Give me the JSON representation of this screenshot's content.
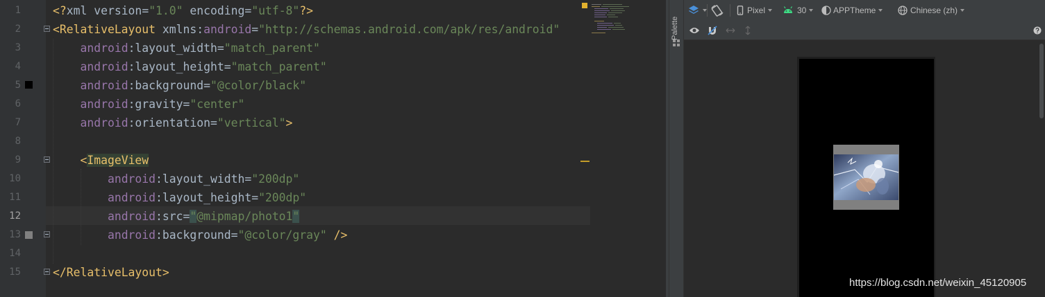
{
  "editor": {
    "line_numbers": [
      "1",
      "2",
      "3",
      "4",
      "5",
      "6",
      "7",
      "8",
      "9",
      "10",
      "11",
      "12",
      "13",
      "14",
      "15"
    ],
    "current_line": "12",
    "lines": [
      {
        "tokens": [
          {
            "t": "<?",
            "c": "t-punct"
          },
          {
            "t": "xml version",
            "c": "t-txt"
          },
          {
            "t": "=",
            "c": "t-txt"
          },
          {
            "t": "\"1.0\"",
            "c": "t-str"
          },
          {
            "t": " encoding",
            "c": "t-txt"
          },
          {
            "t": "=",
            "c": "t-txt"
          },
          {
            "t": "\"utf-8\"",
            "c": "t-str"
          },
          {
            "t": "?>",
            "c": "t-punct"
          }
        ]
      },
      {
        "tokens": [
          {
            "t": "<",
            "c": "t-punct"
          },
          {
            "t": "RelativeLayout",
            "c": "t-tag"
          },
          {
            "t": " xmlns",
            "c": "t-txt"
          },
          {
            "t": ":",
            "c": "t-txt"
          },
          {
            "t": "android",
            "c": "t-ns"
          },
          {
            "t": "=",
            "c": "t-txt"
          },
          {
            "t": "\"http://schemas.android.com/apk/res/android\"",
            "c": "t-str"
          }
        ]
      },
      {
        "tokens": [
          {
            "t": "    ",
            "c": "t-txt"
          },
          {
            "t": "android",
            "c": "t-ns"
          },
          {
            "t": ":layout_width",
            "c": "t-txt"
          },
          {
            "t": "=",
            "c": "t-txt"
          },
          {
            "t": "\"match_parent\"",
            "c": "t-str"
          }
        ]
      },
      {
        "tokens": [
          {
            "t": "    ",
            "c": "t-txt"
          },
          {
            "t": "android",
            "c": "t-ns"
          },
          {
            "t": ":layout_height",
            "c": "t-txt"
          },
          {
            "t": "=",
            "c": "t-txt"
          },
          {
            "t": "\"match_parent\"",
            "c": "t-str"
          }
        ]
      },
      {
        "tokens": [
          {
            "t": "    ",
            "c": "t-txt"
          },
          {
            "t": "android",
            "c": "t-ns"
          },
          {
            "t": ":background",
            "c": "t-txt"
          },
          {
            "t": "=",
            "c": "t-txt"
          },
          {
            "t": "\"@color/black\"",
            "c": "t-str"
          }
        ]
      },
      {
        "tokens": [
          {
            "t": "    ",
            "c": "t-txt"
          },
          {
            "t": "android",
            "c": "t-ns"
          },
          {
            "t": ":gravity",
            "c": "t-txt"
          },
          {
            "t": "=",
            "c": "t-txt"
          },
          {
            "t": "\"center\"",
            "c": "t-str"
          }
        ]
      },
      {
        "tokens": [
          {
            "t": "    ",
            "c": "t-txt"
          },
          {
            "t": "android",
            "c": "t-ns"
          },
          {
            "t": ":orientation",
            "c": "t-txt"
          },
          {
            "t": "=",
            "c": "t-txt"
          },
          {
            "t": "\"vertical\"",
            "c": "t-str"
          },
          {
            "t": ">",
            "c": "t-punct"
          }
        ]
      },
      {
        "tokens": []
      },
      {
        "tokens": [
          {
            "t": "    ",
            "c": "t-txt"
          },
          {
            "t": "<",
            "c": "t-punct"
          },
          {
            "t": "ImageView",
            "c": "t-tag-hl"
          }
        ]
      },
      {
        "tokens": [
          {
            "t": "        ",
            "c": "t-txt"
          },
          {
            "t": "android",
            "c": "t-ns"
          },
          {
            "t": ":layout_width",
            "c": "t-txt"
          },
          {
            "t": "=",
            "c": "t-txt"
          },
          {
            "t": "\"200dp\"",
            "c": "t-str"
          }
        ]
      },
      {
        "tokens": [
          {
            "t": "        ",
            "c": "t-txt"
          },
          {
            "t": "android",
            "c": "t-ns"
          },
          {
            "t": ":layout_height",
            "c": "t-txt"
          },
          {
            "t": "=",
            "c": "t-txt"
          },
          {
            "t": "\"200dp\"",
            "c": "t-str"
          }
        ]
      },
      {
        "tokens": [
          {
            "t": "        ",
            "c": "t-txt"
          },
          {
            "t": "android",
            "c": "t-ns"
          },
          {
            "t": ":src",
            "c": "t-txt"
          },
          {
            "t": "=",
            "c": "t-txt"
          },
          {
            "t": "\"",
            "c": "t-str q-hl"
          },
          {
            "t": "@mipmap/photo1",
            "c": "t-str"
          },
          {
            "t": "\"",
            "c": "t-str q-hl"
          }
        ]
      },
      {
        "tokens": [
          {
            "t": "        ",
            "c": "t-txt"
          },
          {
            "t": "android",
            "c": "t-ns"
          },
          {
            "t": ":background",
            "c": "t-txt"
          },
          {
            "t": "=",
            "c": "t-txt"
          },
          {
            "t": "\"@color/gray\"",
            "c": "t-str"
          },
          {
            "t": " />",
            "c": "t-punct"
          }
        ]
      },
      {
        "tokens": []
      },
      {
        "tokens": [
          {
            "t": "</",
            "c": "t-punct"
          },
          {
            "t": "RelativeLayout",
            "c": "t-tag"
          },
          {
            "t": ">",
            "c": "t-punct"
          }
        ]
      }
    ],
    "gutter_swatches": [
      {
        "line": "5",
        "color": "#000000"
      },
      {
        "line": "13",
        "color": "#808080"
      }
    ]
  },
  "palette": {
    "label": "Palette"
  },
  "toolbar": {
    "device": "Pixel",
    "api_level": "30",
    "theme": "APPTheme",
    "locale": "Chinese (zh)"
  },
  "colors": {
    "editor_bg": "#2b2b2b",
    "gutter_bg": "#313335",
    "panel_bg": "#3c3f41",
    "device_bg": "#000000",
    "imageview_bg": "#808080",
    "accent_blue": "#4a90d9",
    "android_green": "#3ddc84"
  },
  "watermark": "https://blog.csdn.net/weixin_45120905"
}
